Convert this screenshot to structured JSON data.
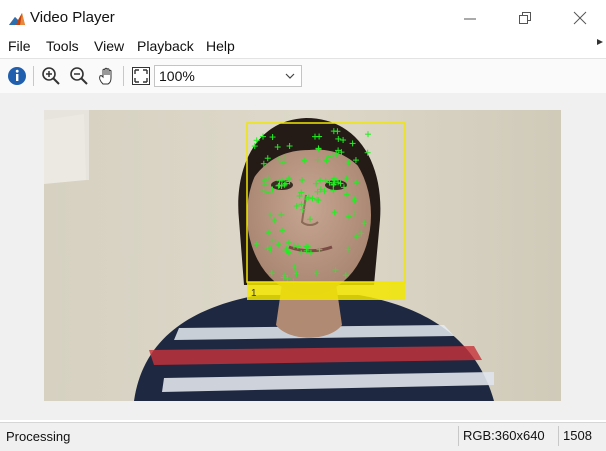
{
  "window": {
    "title": "Video Player"
  },
  "menu": {
    "items": [
      "File",
      "Tools",
      "View",
      "Playback",
      "Help"
    ]
  },
  "toolbar": {
    "buttons": [
      "info-icon",
      "zoom-in-icon",
      "zoom-out-icon",
      "pan-hand-icon",
      "fit-to-window-icon"
    ],
    "zoom_value": "100%"
  },
  "video": {
    "face_box_label": "1",
    "colors": {
      "box": "#f2e600",
      "points": "#22ee22"
    }
  },
  "status": {
    "text": "Processing",
    "pixel_info": "RGB:360x640",
    "frame": "1508"
  }
}
